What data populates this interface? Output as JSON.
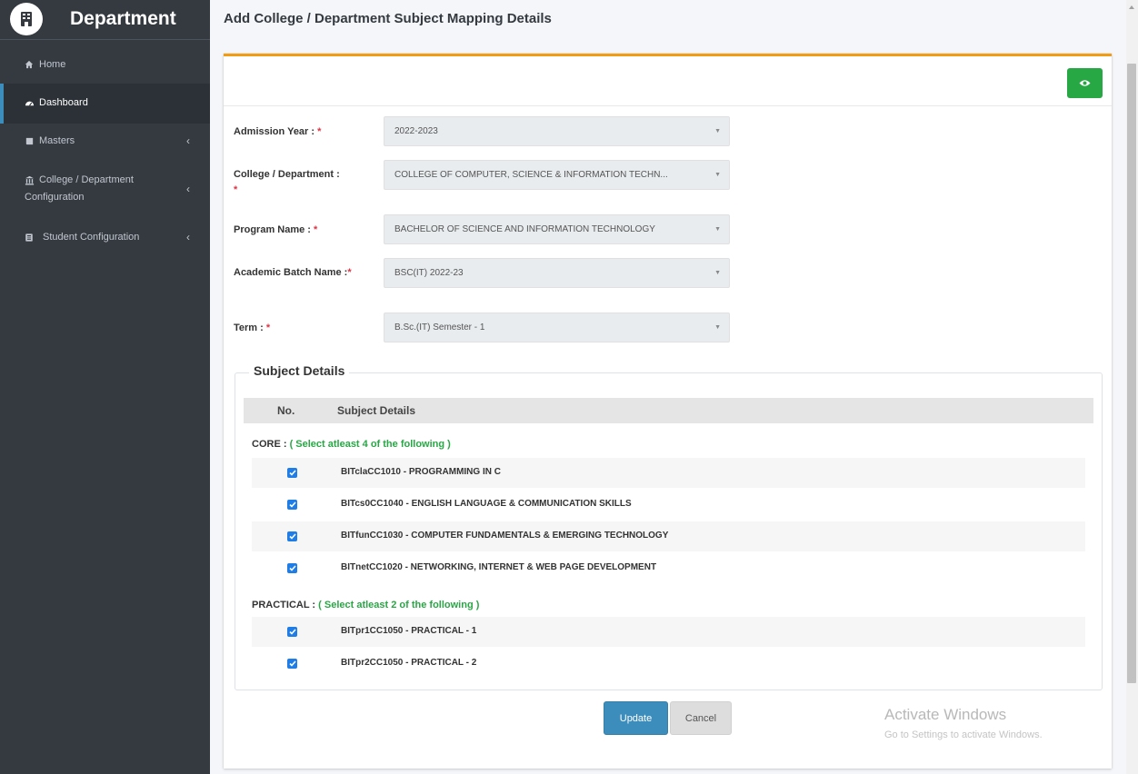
{
  "sidebar": {
    "brand": "Department",
    "items": [
      {
        "label": "Home",
        "icon": "home-icon"
      },
      {
        "label": "Dashboard",
        "icon": "dashboard-icon"
      },
      {
        "label": "Masters",
        "icon": "book-icon"
      },
      {
        "label": "College / Department Configuration",
        "icon": "university-icon"
      },
      {
        "label": "Student Configuration",
        "icon": "id-card-icon"
      }
    ]
  },
  "header": {
    "title": "Add College / Department Subject Mapping Details"
  },
  "form": {
    "admission_year": {
      "label": "Admission Year :",
      "value": "2022-2023"
    },
    "college": {
      "label": "College / Department :",
      "value": "COLLEGE OF COMPUTER, SCIENCE & INFORMATION TECHN..."
    },
    "program": {
      "label": "Program Name :",
      "value": "BACHELOR OF SCIENCE AND INFORMATION TECHNOLOGY"
    },
    "batch": {
      "label": "Academic Batch Name :",
      "value": "BSC(IT) 2022-23"
    },
    "term": {
      "label": "Term :",
      "value": "B.Sc.(IT) Semester - 1"
    },
    "required_mark": "*"
  },
  "subjects": {
    "legend": "Subject Details",
    "col_no": "No.",
    "col_details": "Subject Details",
    "core": {
      "label": "CORE :",
      "hint": "( Select atleast 4 of the following )",
      "items": [
        "BITclaCC1010 - PROGRAMMING IN C",
        "BITcs0CC1040 - ENGLISH LANGUAGE & COMMUNICATION SKILLS",
        "BITfunCC1030 - COMPUTER FUNDAMENTALS & EMERGING TECHNOLOGY",
        "BITnetCC1020 - NETWORKING, INTERNET & WEB PAGE DEVELOPMENT"
      ]
    },
    "practical": {
      "label": "PRACTICAL :",
      "hint": "( Select atleast 2 of the following )",
      "items": [
        "BITpr1CC1050 - PRACTICAL - 1",
        "BITpr2CC1050 - PRACTICAL - 2"
      ]
    }
  },
  "buttons": {
    "update": "Update",
    "cancel": "Cancel"
  },
  "watermark": {
    "line1": "Activate Windows",
    "line2": "Go to Settings to activate Windows."
  },
  "colors": {
    "accent": "#f39c12",
    "primary": "#3c8dbc",
    "success": "#28a745",
    "sidebar": "#343a40"
  }
}
